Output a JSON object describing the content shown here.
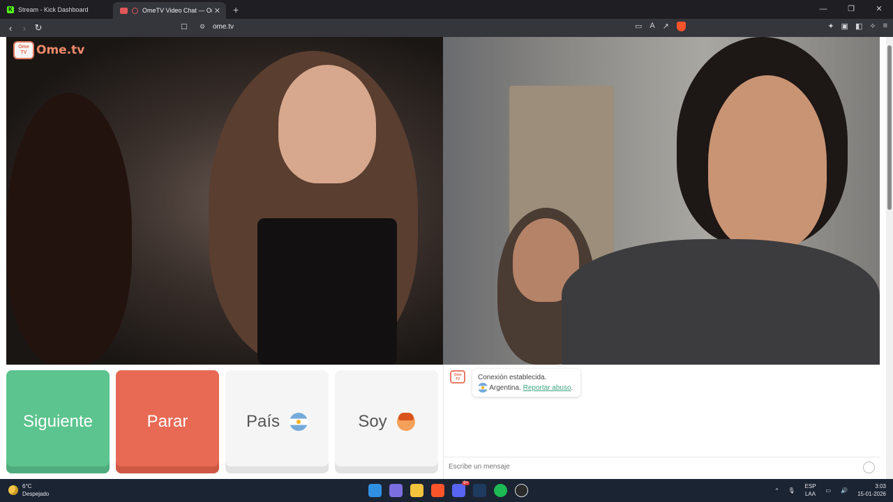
{
  "browser": {
    "tabs": [
      {
        "title": "Stream - Kick Dashboard",
        "active": false
      },
      {
        "title": "OmeTV Video Chat — Omeg",
        "active": true
      }
    ],
    "url": "ome.tv"
  },
  "page": {
    "logo_text": "Ome.tv",
    "logo_badge": "Ome TV",
    "buttons": {
      "next": "Siguiente",
      "stop": "Parar",
      "country": "País",
      "gender": "Soy"
    },
    "chat": {
      "status": "Conexión establecida.",
      "country": "Argentina.",
      "report": "Reportar abuso",
      "report_suffix": ".",
      "input_placeholder": "Escribe un mensaje"
    }
  },
  "taskbar": {
    "weather_temp": "6°C",
    "weather_desc": "Despejado",
    "lang": "ESP",
    "lang_sub": "LAA",
    "time": "3:03",
    "date": "15-01-2026",
    "discord_badge": "9+"
  },
  "colors": {
    "next": "#5cc48e",
    "stop": "#e86a55",
    "accent": "#3aa57f"
  }
}
